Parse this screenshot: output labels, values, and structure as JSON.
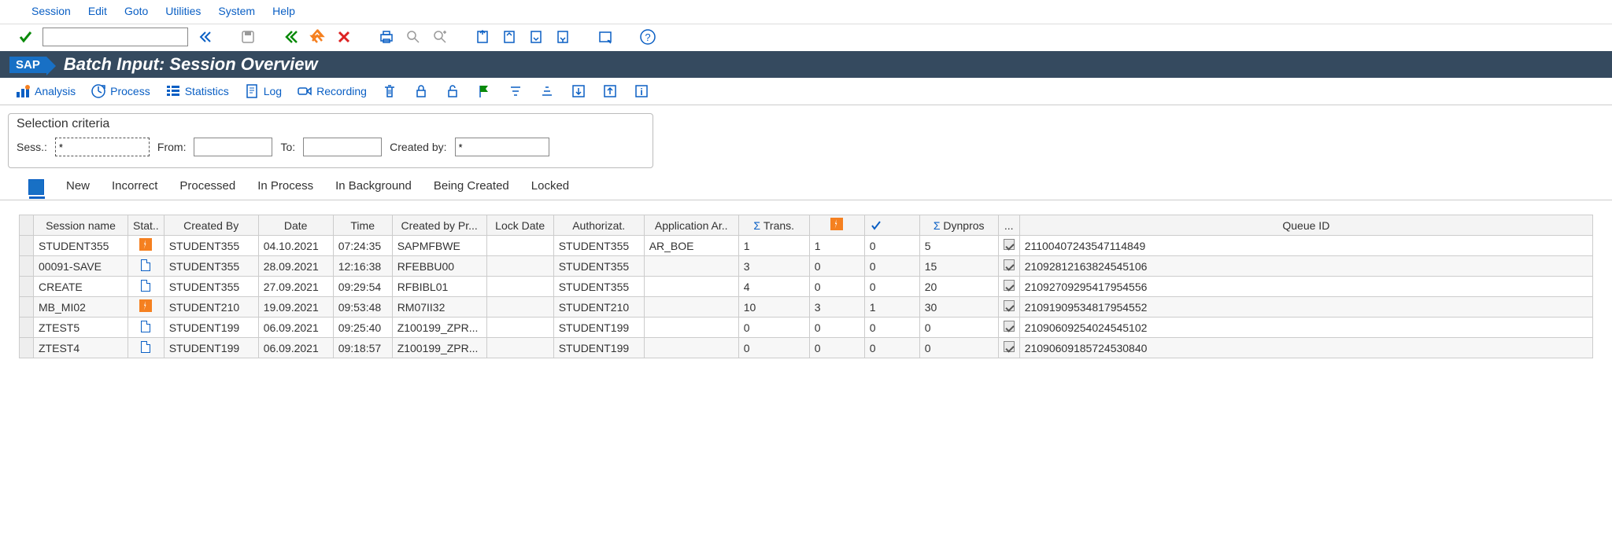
{
  "menu": {
    "items": [
      "Session",
      "Edit",
      "Goto",
      "Utilities",
      "System",
      "Help"
    ]
  },
  "titlebar": {
    "logo": "SAP",
    "title": "Batch Input: Session Overview"
  },
  "toolbar": {
    "analysis": "Analysis",
    "process": "Process",
    "statistics": "Statistics",
    "log": "Log",
    "recording": "Recording"
  },
  "selection": {
    "legend": "Selection criteria",
    "sess_label": "Sess.:",
    "sess_value": "*",
    "from_label": "From:",
    "from_value": "",
    "to_label": "To:",
    "to_value": "",
    "createdby_label": "Created by:",
    "createdby_value": "*"
  },
  "tabs": {
    "items": [
      "New",
      "Incorrect",
      "Processed",
      "In Process",
      "In Background",
      "Being Created",
      "Locked"
    ]
  },
  "grid": {
    "headers": {
      "session_name": "Session name",
      "stat": "Stat..",
      "created_by": "Created By",
      "date": "Date",
      "time": "Time",
      "created_by_pr": "Created by Pr...",
      "lock_date": "Lock Date",
      "authorizat": "Authorizat.",
      "app_area": "Application Ar..",
      "trans": "Trans.",
      "err": "",
      "ok": "",
      "dynpros": "Dynpros",
      "dots": "...",
      "queue_id": "Queue ID"
    },
    "rows": [
      {
        "session": "STUDENT355",
        "stat": "flash",
        "created_by": "STUDENT355",
        "date": "04.10.2021",
        "time": "07:24:35",
        "prog": "SAPMFBWE",
        "lock": "",
        "auth": "STUDENT355",
        "area": "AR_BOE",
        "trans": "1",
        "err": "1",
        "ok": "0",
        "dyn": "5",
        "qid": "21100407243547114849"
      },
      {
        "session": "00091-SAVE",
        "stat": "doc",
        "created_by": "STUDENT355",
        "date": "28.09.2021",
        "time": "12:16:38",
        "prog": "RFEBBU00",
        "lock": "",
        "auth": "STUDENT355",
        "area": "",
        "trans": "3",
        "err": "0",
        "ok": "0",
        "dyn": "15",
        "qid": "21092812163824545106"
      },
      {
        "session": "CREATE",
        "stat": "doc",
        "created_by": "STUDENT355",
        "date": "27.09.2021",
        "time": "09:29:54",
        "prog": "RFBIBL01",
        "lock": "",
        "auth": "STUDENT355",
        "area": "",
        "trans": "4",
        "err": "0",
        "ok": "0",
        "dyn": "20",
        "qid": "21092709295417954556"
      },
      {
        "session": "MB_MI02",
        "stat": "flash",
        "created_by": "STUDENT210",
        "date": "19.09.2021",
        "time": "09:53:48",
        "prog": "RM07II32",
        "lock": "",
        "auth": "STUDENT210",
        "area": "",
        "trans": "10",
        "err": "3",
        "ok": "1",
        "dyn": "30",
        "qid": "21091909534817954552"
      },
      {
        "session": "ZTEST5",
        "stat": "doc",
        "created_by": "STUDENT199",
        "date": "06.09.2021",
        "time": "09:25:40",
        "prog": "Z100199_ZPR...",
        "lock": "",
        "auth": "STUDENT199",
        "area": "",
        "trans": "0",
        "err": "0",
        "ok": "0",
        "dyn": "0",
        "qid": "21090609254024545102"
      },
      {
        "session": "ZTEST4",
        "stat": "doc",
        "created_by": "STUDENT199",
        "date": "06.09.2021",
        "time": "09:18:57",
        "prog": "Z100199_ZPR...",
        "lock": "",
        "auth": "STUDENT199",
        "area": "",
        "trans": "0",
        "err": "0",
        "ok": "0",
        "dyn": "0",
        "qid": "21090609185724530840"
      }
    ]
  }
}
